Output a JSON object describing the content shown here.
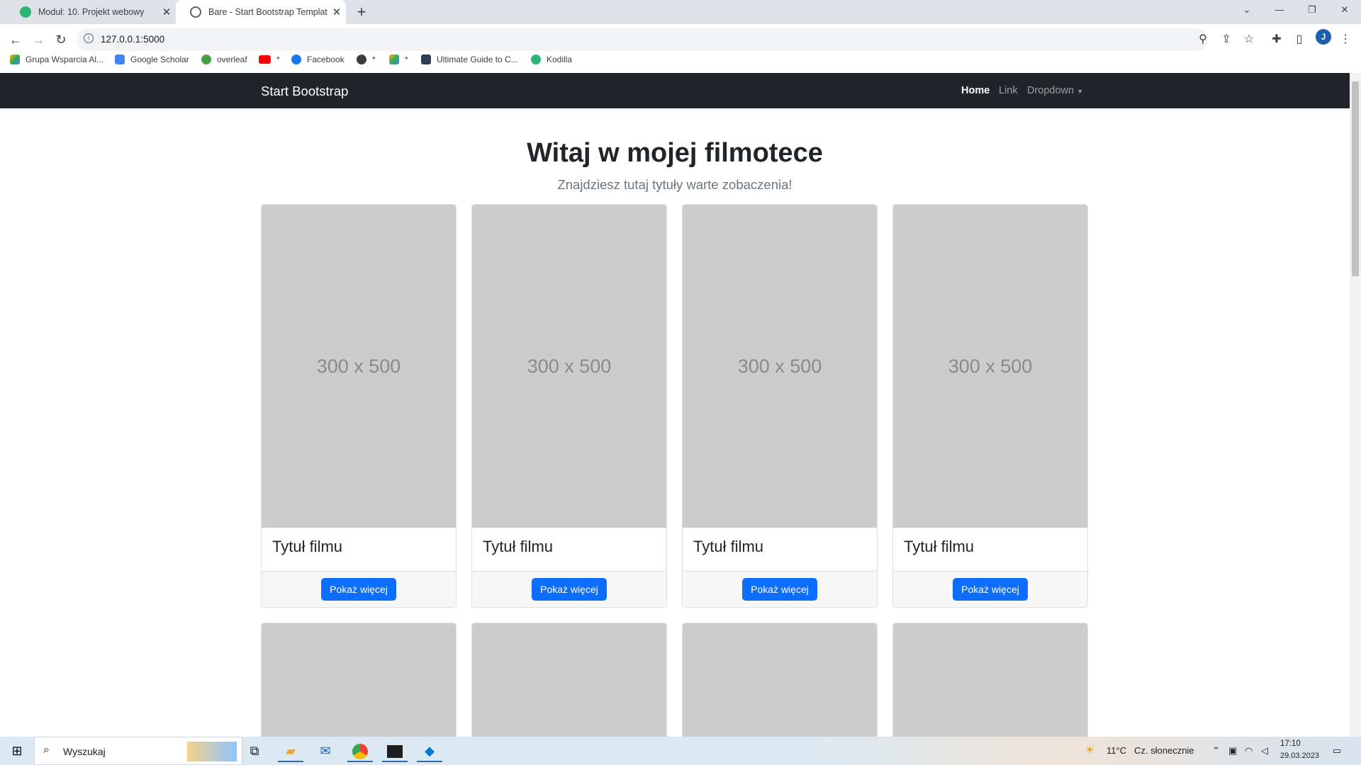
{
  "browser": {
    "tabs": [
      {
        "title": "Moduł: 10. Projekt webowy",
        "active": false
      },
      {
        "title": "Bare - Start Bootstrap Template",
        "active": true
      }
    ],
    "url": "127.0.0.1:5000",
    "profile_initial": "J",
    "bookmarks": [
      "Grupa Wsparcia Al...",
      "Google Scholar",
      "overleaf",
      "*",
      "Facebook",
      "*",
      "*",
      "Ultimate Guide to C...",
      "Kodilla"
    ]
  },
  "navbar": {
    "brand": "Start Bootstrap",
    "links": [
      "Home",
      "Link",
      "Dropdown"
    ],
    "active_link": "Home"
  },
  "page": {
    "title": "Witaj w mojej filmotece",
    "subtitle": "Znajdziesz tutaj tytuły warte zobaczenia!"
  },
  "cards": [
    {
      "placeholder": "300 x 500",
      "title": "Tytuł filmu",
      "button": "Pokaż więcej"
    },
    {
      "placeholder": "300 x 500",
      "title": "Tytuł filmu",
      "button": "Pokaż więcej"
    },
    {
      "placeholder": "300 x 500",
      "title": "Tytuł filmu",
      "button": "Pokaż więcej"
    },
    {
      "placeholder": "300 x 500",
      "title": "Tytuł filmu",
      "button": "Pokaż więcej"
    }
  ],
  "taskbar": {
    "search_placeholder": "Wyszukaj",
    "weather": "11°C",
    "weather_desc": "Cz. słonecznie",
    "time": "17:10",
    "date": "29.03.2023"
  },
  "colors": {
    "navbar": "#212529",
    "primary_button": "#0d6efd",
    "placeholder": "#cccccc"
  }
}
